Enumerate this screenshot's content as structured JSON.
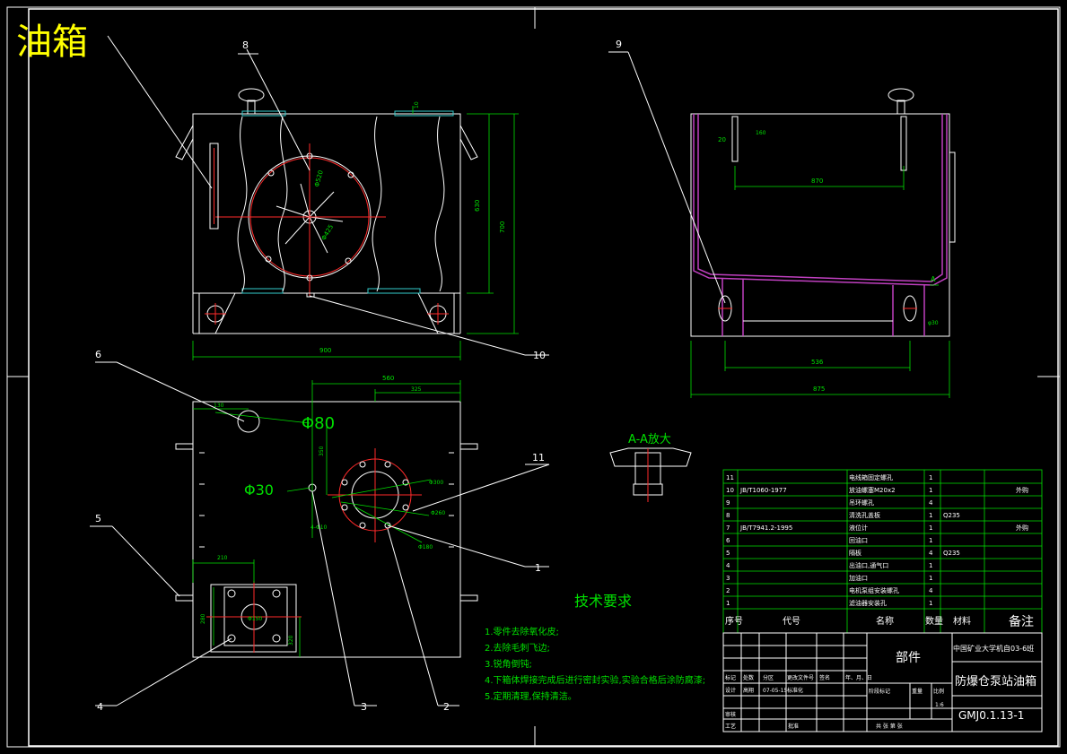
{
  "title": "油箱",
  "balloons": [
    "8",
    "9",
    "10",
    "6",
    "11",
    "1",
    "5",
    "4",
    "3",
    "2"
  ],
  "dims": {
    "front_width": "900",
    "front_h1": "630",
    "front_h2": "700",
    "front_top": "10",
    "side_20": "20",
    "side_top": "160",
    "side_870": "870",
    "side_536": "536",
    "side_875": "875",
    "side_hole": "φ30",
    "top_560": "560",
    "top_325": "325",
    "top_130": "130",
    "top_350": "350",
    "top_210": "210",
    "top_280": "280",
    "top_320": "320",
    "phi80": "Φ80",
    "phi30": "Φ30",
    "flange_1": "Φ300",
    "flange_2": "Φ260",
    "flange_3": "Φ180",
    "flange_4": "4-Φ10",
    "flange_5": "Φ150",
    "front_circle": "Φ520",
    "front_circle2": "Φ425"
  },
  "detail_label": "A-A放大",
  "section_mark": "A",
  "tech": {
    "heading": "技术要求",
    "items": [
      "1.零件去除氧化皮;",
      "2.去除毛刺飞边;",
      "3.锐角倒钝;",
      "4.下箱体焊接完成后进行密封实验,实验合格后涂防腐漆;",
      "5.定期清理,保持清洁。"
    ]
  },
  "bom": {
    "header": [
      "序号",
      "代号",
      "名称",
      "数量",
      "材料",
      "备注"
    ],
    "rows": [
      [
        "11",
        "",
        "电线箱固定螺孔",
        "1",
        "",
        ""
      ],
      [
        "10",
        "JB/T1060-1977",
        "放油螺塞M20x2",
        "1",
        "",
        "外购"
      ],
      [
        "9",
        "",
        "吊环螺孔",
        "4",
        "",
        ""
      ],
      [
        "8",
        "",
        "清洗孔盖板",
        "1",
        "Q235",
        ""
      ],
      [
        "7",
        "JB/T7941.2-1995",
        "液位计",
        "1",
        "",
        "外购"
      ],
      [
        "6",
        "",
        "回油口",
        "1",
        "",
        ""
      ],
      [
        "5",
        "",
        "隔板",
        "4",
        "Q235",
        ""
      ],
      [
        "4",
        "",
        "出油口,通气口",
        "1",
        "",
        ""
      ],
      [
        "3",
        "",
        "加油口",
        "1",
        "",
        ""
      ],
      [
        "2",
        "",
        "电机泵组安装螺孔",
        "4",
        "",
        ""
      ],
      [
        "1",
        "",
        "滤油器安装孔",
        "1",
        "",
        ""
      ]
    ]
  },
  "titleblock": {
    "part_type": "部件",
    "school": "中国矿业大学机自03-6班",
    "name": "防爆仓泵站油箱",
    "drawing_no": "GMJ0.1.13-1",
    "scale": "1:6",
    "labels": {
      "mark": "标记",
      "count": "处数",
      "zone": "分区",
      "change_doc": "更改文件号",
      "sign": "签名",
      "date": "年、月、日",
      "design": "设计",
      "designer": "高翔",
      "design_date": "07-05-15",
      "standard": "标准化",
      "stage_mark": "阶段标记",
      "weight": "重量",
      "scale_label": "比例",
      "review": "审核",
      "process": "工艺",
      "approve": "批准",
      "sheets": "共 张 第 张"
    }
  },
  "colors": {
    "background": "#000000",
    "outline": "#ffffff",
    "dimension": "#00e000",
    "centerline": "#ff2a2a",
    "section": "#c040c0",
    "title": "#ffff00"
  }
}
